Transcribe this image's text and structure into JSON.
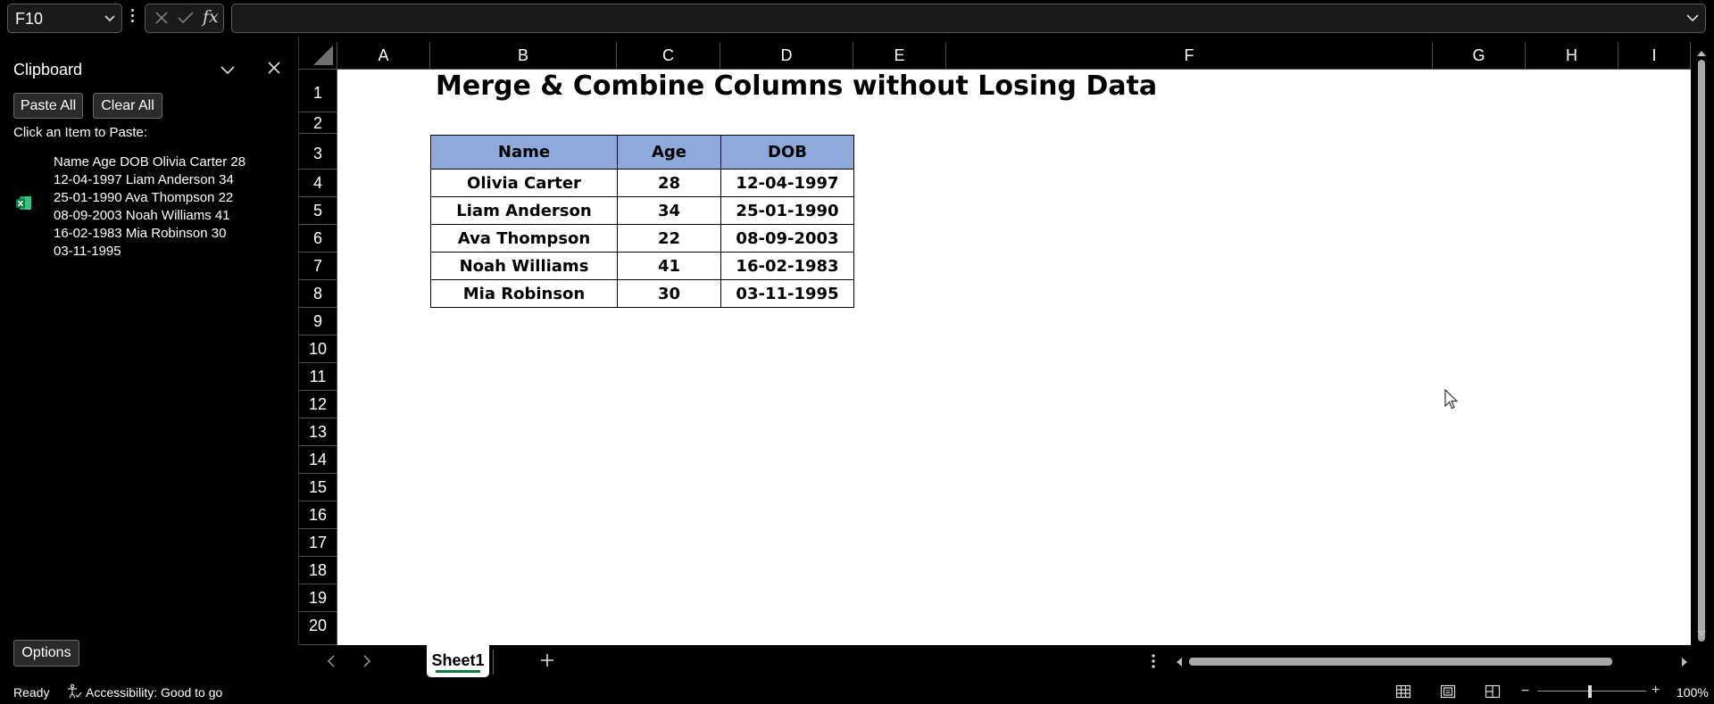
{
  "formula_bar": {
    "name_box": "F10",
    "formula_value": ""
  },
  "clipboard": {
    "title": "Clipboard",
    "paste_all": "Paste All",
    "clear_all": "Clear All",
    "hint": "Click an Item to Paste:",
    "items": [
      {
        "lines": [
          "Name Age DOB Olivia Carter 28",
          "12-04-1997 Liam Anderson 34",
          "25-01-1990 Ava Thompson 22",
          "08-09-2003 Noah Williams 41",
          "16-02-1983 Mia Robinson 30",
          "03-11-1995"
        ],
        "icon": "excel-icon"
      }
    ],
    "options": "Options"
  },
  "grid": {
    "columns": [
      "A",
      "B",
      "C",
      "D",
      "E",
      "F",
      "G",
      "H",
      "I"
    ],
    "rows": [
      "1",
      "2",
      "3",
      "4",
      "5",
      "6",
      "7",
      "8",
      "9",
      "10",
      "11",
      "12",
      "13",
      "14",
      "15",
      "16",
      "17",
      "18",
      "19",
      "20"
    ]
  },
  "sheet": {
    "title": "Merge & Combine Columns without Losing Data",
    "table": {
      "headers": [
        "Name",
        "Age",
        "DOB"
      ],
      "header_fill": "#8eaadb",
      "rows": [
        [
          "Olivia Carter",
          "28",
          "12-04-1997"
        ],
        [
          "Liam Anderson",
          "34",
          "25-01-1990"
        ],
        [
          "Ava Thompson",
          "22",
          "08-09-2003"
        ],
        [
          "Noah Williams",
          "41",
          "16-02-1983"
        ],
        [
          "Mia Robinson",
          "30",
          "03-11-1995"
        ]
      ]
    }
  },
  "tabs": {
    "active": "Sheet1"
  },
  "status": {
    "ready": "Ready",
    "accessibility": "Accessibility: Good to go",
    "zoom": "100%"
  },
  "colors": {
    "background": "#000000",
    "accent_green": "#107c41",
    "sheet": "#ffffff"
  }
}
